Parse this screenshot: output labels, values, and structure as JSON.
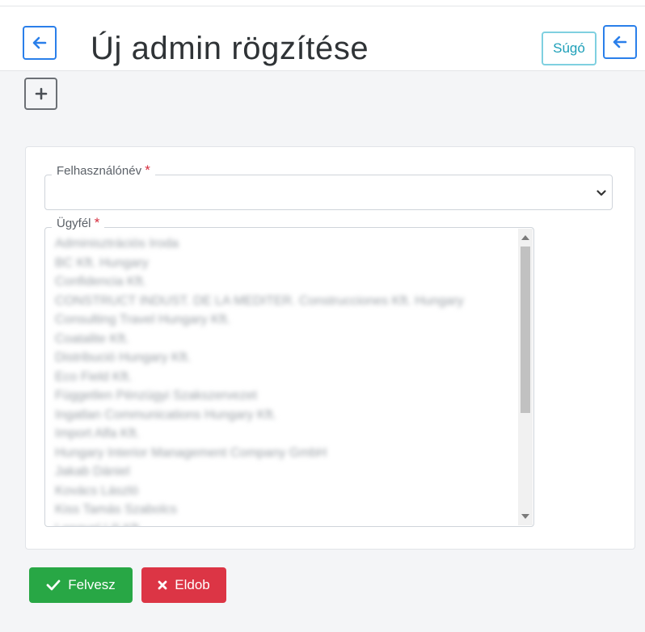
{
  "colors": {
    "primary": "#2a7fea",
    "success": "#28a745",
    "danger": "#dc3545",
    "info": "#1d9fb8"
  },
  "header": {
    "title": "Új admin rögzítése",
    "back_icon": "arrow-left-icon",
    "help_label": "Súgó"
  },
  "toolbar": {
    "add_icon": "plus-icon"
  },
  "form": {
    "username": {
      "label": "Felhasználónév",
      "required_mark": "*",
      "value": "",
      "icon": "chevron-down-icon"
    },
    "client": {
      "label": "Ügyfél",
      "required_mark": "*",
      "options": [
        "Adminisztrációs Iroda",
        "BC Kft. Hungary",
        "Confidencia Kft.",
        "CONSTRUCT INDUST. DE LA MEDITER. Construcciones Kft. Hungary",
        "Consulting Travel Hungary Kft.",
        "Coatalite Kft.",
        "Distribució Hungary Kft.",
        "Eco Field Kft.",
        "Független Pénzügyi Szakszervezet",
        "Ingatlan Communications Hungary Kft.",
        "Import Alfa Kft.",
        "Hungary Interior Management Company GmbH",
        "Jakab Dániel",
        "Kovács László",
        "Kiss Tamás Szabolcs",
        "Lengyel Lili Kft."
      ]
    }
  },
  "actions": {
    "submit_label": "Felvesz",
    "submit_icon": "check-icon",
    "cancel_label": "Eldob",
    "cancel_icon": "x-icon"
  }
}
